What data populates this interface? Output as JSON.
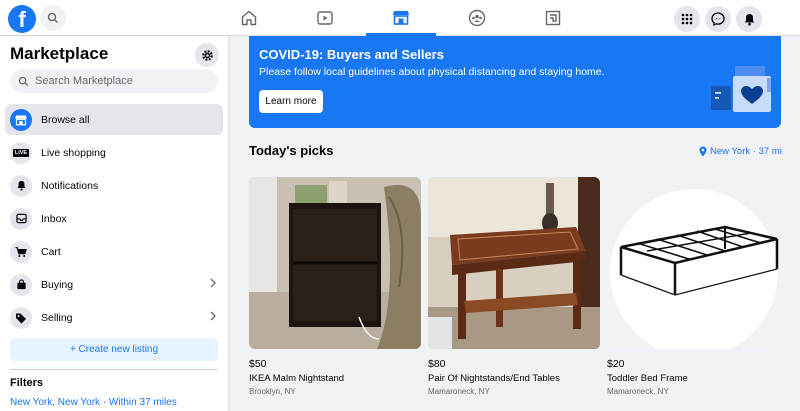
{
  "topbar": {
    "logo_letter": "f",
    "nav_tabs": [
      "home",
      "watch",
      "marketplace",
      "groups",
      "gaming"
    ],
    "active_tab": "marketplace"
  },
  "sidebar": {
    "title": "Marketplace",
    "search_placeholder": "Search Marketplace",
    "items": [
      {
        "label": "Browse all",
        "icon": "storefront-icon",
        "active": true
      },
      {
        "label": "Live shopping",
        "icon": "live-icon"
      },
      {
        "label": "Notifications",
        "icon": "bell-icon"
      },
      {
        "label": "Inbox",
        "icon": "inbox-icon"
      },
      {
        "label": "Cart",
        "icon": "cart-icon"
      },
      {
        "label": "Buying",
        "icon": "bag-icon",
        "chevron": true
      },
      {
        "label": "Selling",
        "icon": "tag-icon",
        "chevron": true
      }
    ],
    "live_badge": "LIVE",
    "create_listing": "+ Create new listing",
    "filters_title": "Filters",
    "filters_location": "New York, New York · Within 37 miles"
  },
  "banner": {
    "title": "COVID-19: Buyers and Sellers",
    "text": "Please follow local guidelines about physical distancing and staying home.",
    "button": "Learn more"
  },
  "picks": {
    "title": "Today's picks",
    "location": "New York · 37 mi",
    "cards": [
      {
        "price": "$50",
        "title": "IKEA Malm Nightstand",
        "location": "Brooklyn, NY"
      },
      {
        "price": "$80",
        "title": "Pair Of Nightstands/End Tables",
        "location": "Mamaroneck, NY"
      },
      {
        "price": "$20",
        "title": "Toddler Bed Frame",
        "location": "Mamaroneck, NY"
      }
    ]
  },
  "colors": {
    "accent": "#1877f2",
    "background": "#f0f2f5"
  }
}
